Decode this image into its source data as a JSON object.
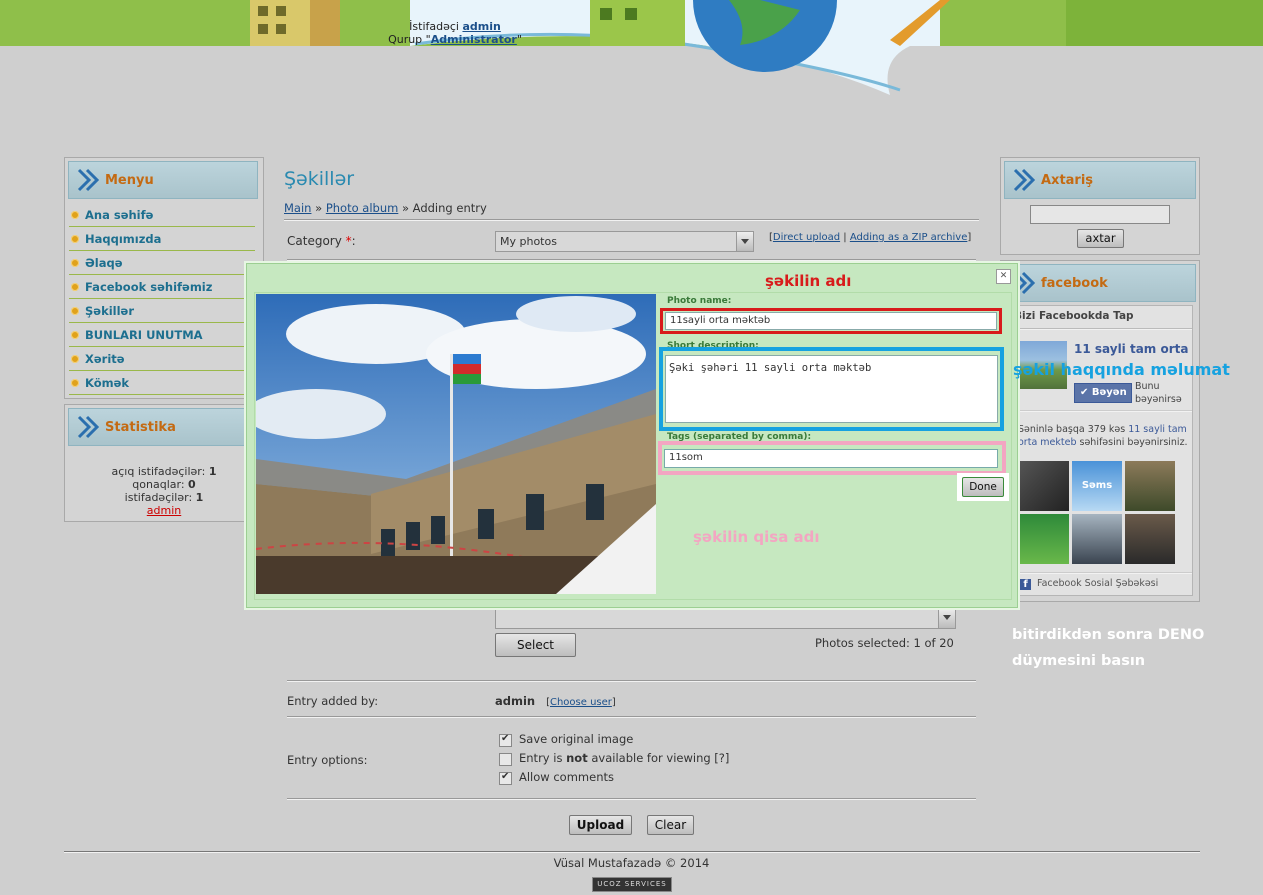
{
  "header": {
    "user_prefix": "İstifadəçi",
    "user_name": "admin",
    "group_prefix": "Qurup \"",
    "group_name": "Administrator",
    "group_suffix": "\""
  },
  "left_menu": {
    "title": "Menyu",
    "items": [
      {
        "label": "Ana səhifə"
      },
      {
        "label": "Haqqımızda"
      },
      {
        "label": "Əlaqə"
      },
      {
        "label": "Facebook səhifəmiz"
      },
      {
        "label": "Şəkillər"
      },
      {
        "label": "BUNLARI UNUTMA"
      },
      {
        "label": "Xəritə"
      },
      {
        "label": "Kömək"
      }
    ]
  },
  "stats": {
    "title": "Statistika",
    "online_label": "açıq istifadəçilər:",
    "online_value": "1",
    "guests_label": "qonaqlar:",
    "guests_value": "0",
    "users_label": "istifadəçilər:",
    "users_value": "1",
    "user_link": "admin"
  },
  "main": {
    "page_title": "Şəkillər",
    "breadcrumb": {
      "main": "Main",
      "sep": "»",
      "album": "Photo album",
      "current": "Adding entry"
    },
    "category_label": "Category",
    "category_required": "*",
    "category_colon": ":",
    "category_value": "My photos",
    "direct_upload": "Direct upload",
    "zip_archive": "Adding as a ZIP archive",
    "select_button": "Select",
    "photos_selected": "Photos selected: 1 of 20",
    "entry_added_by_label": "Entry added by:",
    "entry_added_by_value": "admin",
    "choose_user": "Choose user",
    "entry_options_label": "Entry options:",
    "options": [
      {
        "label": "Save original image",
        "checked": true
      },
      {
        "label_pre": "Entry is ",
        "label_bold": "not",
        "label_post": " available for viewing [?]",
        "checked": false
      },
      {
        "label": "Allow comments",
        "checked": true
      }
    ],
    "upload_button": "Upload",
    "clear_button": "Clear"
  },
  "modal": {
    "photo_name_label": "Photo name:",
    "photo_name_value": "11sayli orta məktəb",
    "short_desc_label": "Short description:",
    "short_desc_value": "Şəki şəhəri 11 sayli orta məktəb",
    "tags_label": "Tags (separated by comma):",
    "tags_value": "11som",
    "done_button": "Done",
    "close_symbol": "✕"
  },
  "annotations": {
    "name": "şəkilin adı",
    "description": "şəkil haqqında məlumat",
    "tags": "şəkilin qisa adı",
    "done_hint_1": "bitirdikdən sonra DENO",
    "done_hint_2": "düymesini basın"
  },
  "right": {
    "search_title": "Axtariş",
    "search_button": "axtar",
    "facebook_title": "facebook",
    "fb_header": "Bizi Facebookda Tap",
    "fb_page_name": "11 sayli tam orta məktəb",
    "fb_like": "Bəyən",
    "fb_like_note_1": "Bunu",
    "fb_like_note_2": "bəyənirsə",
    "fb_count_pre": "Səninlə başqa 379 kəs ",
    "fb_count_link": "11 sayli tam orta mekteb",
    "fb_count_post": " səhifəsini bəyənirsiniz.",
    "fb_friend_label": "Səms",
    "fb_footer": "Facebook Sosial Şəbəkəsi"
  },
  "footer": {
    "copyright": "Vüsal Mustafazadə © 2014",
    "badge": "UCOZ SERVICES"
  },
  "colors": {
    "accent_blue": "#2a8ab0",
    "menu_orange": "#c46a12",
    "annot_red": "#d81b1b",
    "annot_blue": "#16a2e0",
    "annot_pink": "#f3a6c2",
    "modal_green": "#c6e8c0"
  }
}
